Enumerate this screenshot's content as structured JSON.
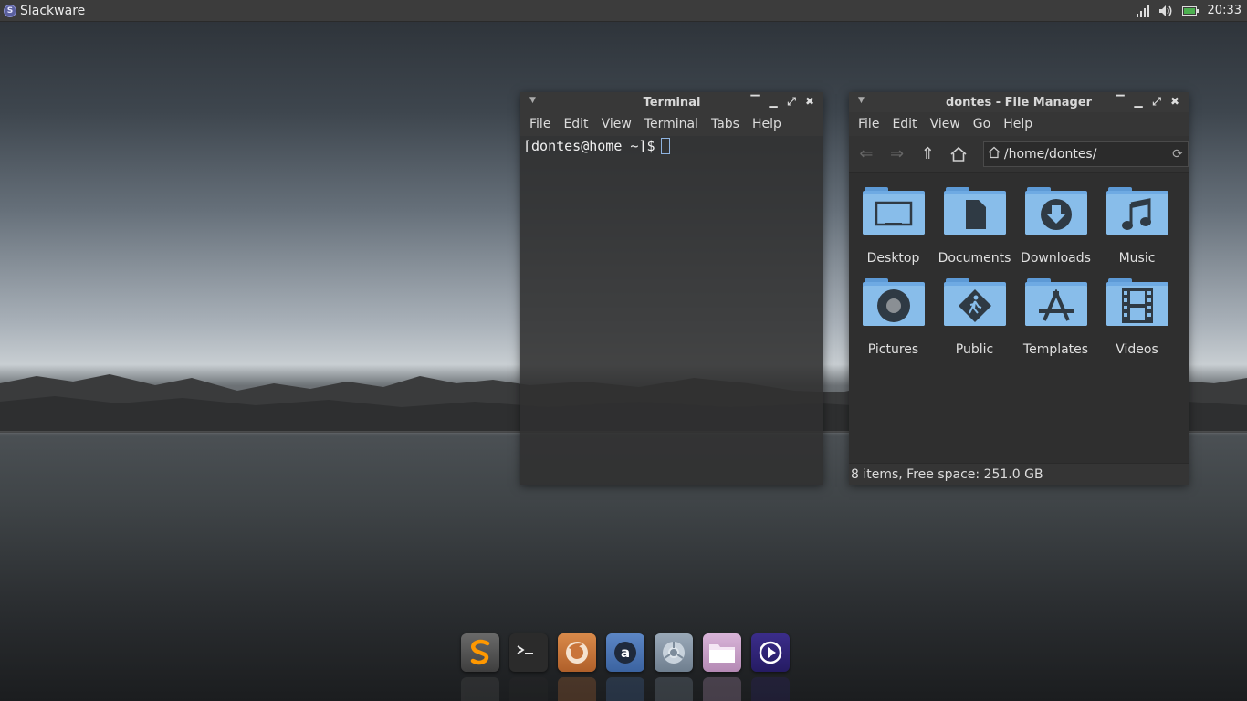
{
  "top_panel": {
    "menu_label": "Slackware",
    "clock": "20:33"
  },
  "terminal": {
    "title": "Terminal",
    "menu": [
      "File",
      "Edit",
      "View",
      "Terminal",
      "Tabs",
      "Help"
    ],
    "prompt": "[dontes@home ~]$"
  },
  "file_manager": {
    "title": "dontes - File Manager",
    "menu": [
      "File",
      "Edit",
      "View",
      "Go",
      "Help"
    ],
    "path": "/home/dontes/",
    "items": [
      "Desktop",
      "Documents",
      "Downloads",
      "Music",
      "Pictures",
      "Public",
      "Templates",
      "Videos"
    ],
    "status": "8 items, Free space: 251.0 GB"
  },
  "dock": {
    "apps": [
      "sublime-text-icon",
      "terminal-icon",
      "firefox-icon",
      "amazon-icon",
      "chromium-icon",
      "files-icon",
      "media-player-icon"
    ]
  },
  "colors": {
    "folder": "#88bdea",
    "panel": "#3c3c3c",
    "window": "#333333"
  }
}
